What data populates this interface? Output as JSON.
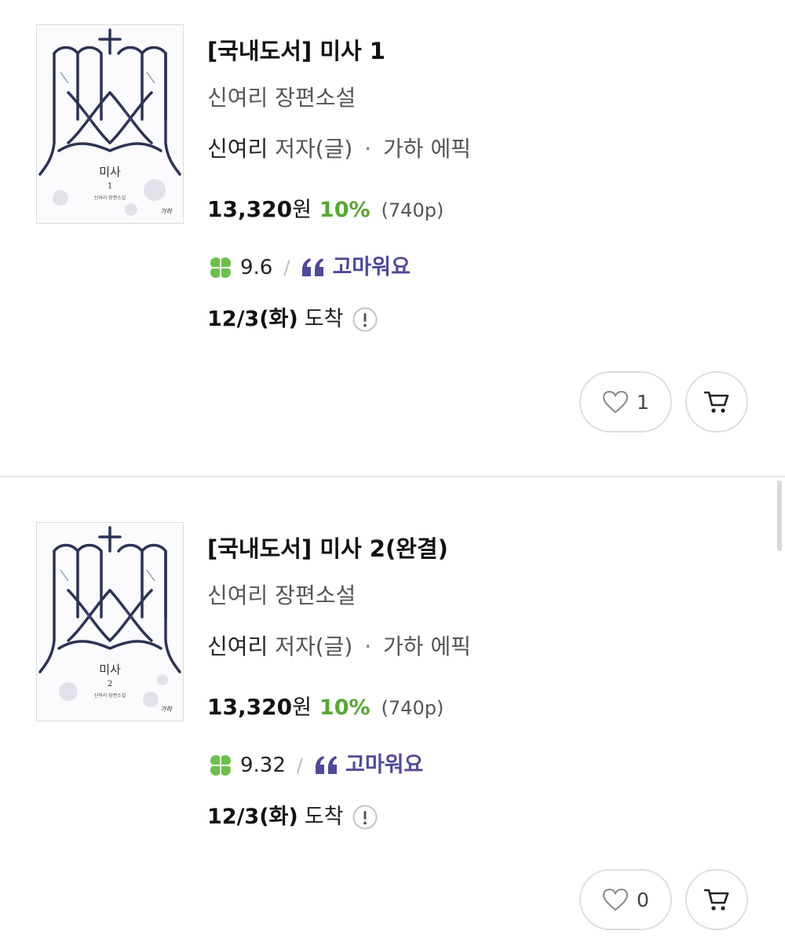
{
  "items": [
    {
      "title": "[국내도서] 미사 1",
      "subtitle": "신여리 장편소설",
      "author": "신여리",
      "author_role": "저자(글)",
      "separator": "·",
      "publisher": "가하 에픽",
      "price": "13,320",
      "currency": "원",
      "discount": "10%",
      "pages": "(740p)",
      "rating": "9.6",
      "rating_separator": "/",
      "thanks_label": "고마워요",
      "arrival_date": "12/3(화)",
      "arrival_label": "도착",
      "like_count": "1",
      "cover_title": "미사",
      "cover_volume": "1",
      "cover_caption": "신여리 장편소설",
      "cover_publisher_mark": "가하"
    },
    {
      "title": "[국내도서] 미사 2(완결)",
      "subtitle": "신여리 장편소설",
      "author": "신여리",
      "author_role": "저자(글)",
      "separator": "·",
      "publisher": "가하 에픽",
      "price": "13,320",
      "currency": "원",
      "discount": "10%",
      "pages": "(740p)",
      "rating": "9.32",
      "rating_separator": "/",
      "thanks_label": "고마워요",
      "arrival_date": "12/3(화)",
      "arrival_label": "도착",
      "like_count": "0",
      "cover_title": "미사",
      "cover_volume": "2",
      "cover_caption": "신여리 장편소설",
      "cover_publisher_mark": "가하"
    }
  ],
  "icons": {
    "clover": "clover-icon",
    "quote": "quote-icon",
    "info": "info-icon",
    "heart": "heart-icon",
    "cart": "cart-icon"
  },
  "colors": {
    "discount": "#59a634",
    "clover": "#6cc04a",
    "thanks": "#4f4a99",
    "border": "#dedede"
  }
}
